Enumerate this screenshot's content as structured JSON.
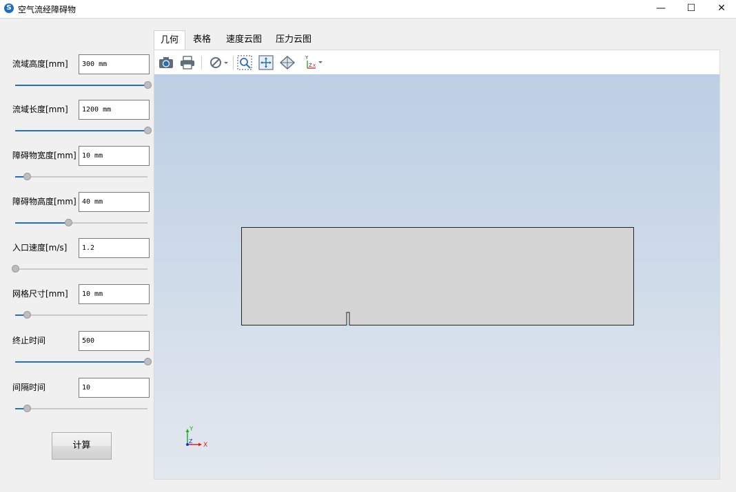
{
  "window": {
    "title": "空气流经障碍物",
    "controls": {
      "minimize": "—",
      "maximize": "☐",
      "close": "✕"
    }
  },
  "params": [
    {
      "label": "流域高度[mm]",
      "value": "300 mm",
      "slider_fraction": 1.0
    },
    {
      "label": "流域长度[mm]",
      "value": "1200 mm",
      "slider_fraction": 1.0
    },
    {
      "label": "障碍物宽度[mm]",
      "value": "10 mm",
      "slider_fraction": 0.09
    },
    {
      "label": "障碍物高度[mm]",
      "value": "40 mm",
      "slider_fraction": 0.4
    },
    {
      "label": "入口速度[m/s]",
      "value": "1.2",
      "slider_fraction": 0.0
    },
    {
      "label": "网格尺寸[mm]",
      "value": "10 mm",
      "slider_fraction": 0.09
    },
    {
      "label": "终止时间",
      "value": "500",
      "slider_fraction": 1.0
    },
    {
      "label": "间隔时间",
      "value": "10",
      "slider_fraction": 0.09
    }
  ],
  "calculate_label": "计算",
  "tabs": [
    {
      "label": "几何",
      "active": true
    },
    {
      "label": "表格",
      "active": false
    },
    {
      "label": "速度云图",
      "active": false
    },
    {
      "label": "压力云图",
      "active": false
    }
  ],
  "toolbar_icons": [
    "camera-icon",
    "print-icon",
    "visibility-icon",
    "zoom-box-icon",
    "fit-view-icon",
    "view-orient-icon",
    "axes-triad-icon"
  ],
  "axes": {
    "x": "X",
    "y": "Y",
    "z": "Z"
  },
  "colors": {
    "accent": "#1f6fc5",
    "domain_fill": "#d4d4d4",
    "axis_x": "#e02020",
    "axis_y": "#20b020",
    "axis_z": "#2030e0"
  }
}
